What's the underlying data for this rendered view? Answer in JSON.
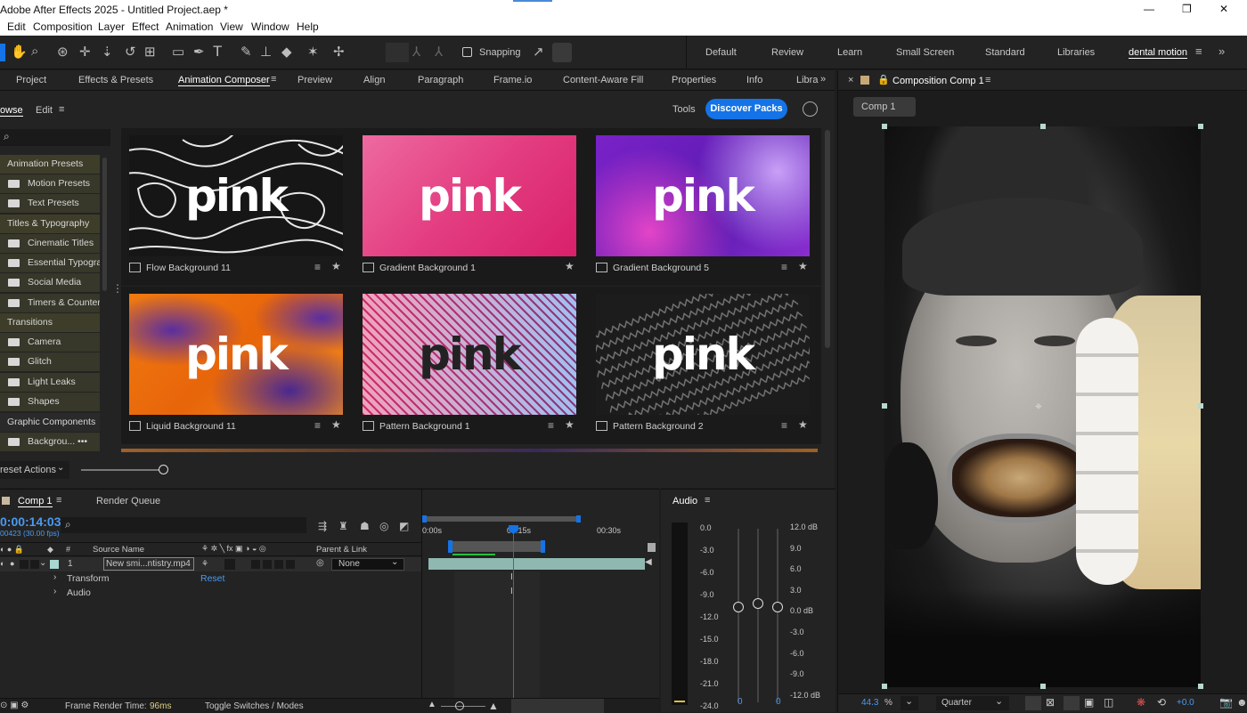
{
  "titlebar": {
    "title": "Adobe After Effects 2025 - Untitled Project.aep *",
    "minimize": "—",
    "maximize": "❐",
    "close": "✕"
  },
  "menu": [
    "Edit",
    "Composition",
    "Layer",
    "Effect",
    "Animation",
    "View",
    "Window",
    "Help"
  ],
  "toolbar": {
    "snapping": "Snapping"
  },
  "workspaces": [
    "Default",
    "Review",
    "Learn",
    "Small Screen",
    "Standard",
    "Libraries",
    "dental motion"
  ],
  "panel_tabs": [
    "Project",
    "Effects & Presets",
    "Animation Composer",
    "Preview",
    "Align",
    "Paragraph",
    "Frame.io",
    "Content-Aware Fill",
    "Properties",
    "Info",
    "Libra"
  ],
  "ac": {
    "browse": "owse",
    "edit": "Edit",
    "tools": "Tools",
    "discover": "Discover Packs",
    "preset_actions": "reset Actions"
  },
  "categories": [
    {
      "label": "Animation Presets",
      "sub": false
    },
    {
      "label": "Motion Presets",
      "sub": true
    },
    {
      "label": "Text Presets",
      "sub": true
    },
    {
      "label": "Titles & Typography",
      "sub": false
    },
    {
      "label": "Cinematic Titles",
      "sub": true
    },
    {
      "label": "Essential Typogra",
      "sub": true
    },
    {
      "label": "Social Media",
      "sub": true
    },
    {
      "label": "Timers & Counter",
      "sub": true
    },
    {
      "label": "Transitions",
      "sub": false
    },
    {
      "label": "Camera",
      "sub": true
    },
    {
      "label": "Glitch",
      "sub": true
    },
    {
      "label": "Light Leaks",
      "sub": true
    },
    {
      "label": "Shapes",
      "sub": true
    },
    {
      "label": "Graphic Components",
      "sub": false
    },
    {
      "label": "Backgrou... •••",
      "sub": true
    }
  ],
  "cards": [
    {
      "label": "Flow Background 11",
      "word": "pink"
    },
    {
      "label": "Gradient Background 1",
      "word": "pink"
    },
    {
      "label": "Gradient Background 5",
      "word": "pink"
    },
    {
      "label": "Liquid Background 11",
      "word": "pink"
    },
    {
      "label": "Pattern Background 1",
      "word": "pink"
    },
    {
      "label": "Pattern Background 2",
      "word": "pink"
    }
  ],
  "timeline": {
    "tab": "Comp 1",
    "render_queue": "Render Queue",
    "timecode": "0:00:14:03",
    "fps": "00423 (30.00 fps)",
    "col_source": "Source Name",
    "col_parent": "Parent & Link",
    "layer_num": "1",
    "layer_name": "New smi...ntistry.mp4",
    "parent": "None",
    "transform": "Transform",
    "reset": "Reset",
    "audio": "Audio",
    "ruler": [
      "0:00s",
      "00:15s",
      "00:30s"
    ],
    "frame_render": "Frame Render Time:",
    "frame_render_val": "96ms",
    "toggle": "Toggle Switches / Modes"
  },
  "audio": {
    "title": "Audio",
    "left_scale": [
      "0.0",
      "-3.0",
      "-6.0",
      "-9.0",
      "-12.0",
      "-15.0",
      "-18.0",
      "-21.0",
      "-24.0"
    ],
    "right_scale": [
      "12.0 dB",
      "9.0",
      "6.0",
      "3.0",
      "0.0 dB",
      "-3.0",
      "-6.0",
      "-9.0",
      "-12.0 dB"
    ],
    "val_left": "0",
    "val_right": "0"
  },
  "comp": {
    "tab": "Composition Comp 1",
    "chip": "Comp 1",
    "zoom": "44.3",
    "zoom_unit": "%",
    "quality": "Quarter",
    "exposure": "+0.0"
  }
}
